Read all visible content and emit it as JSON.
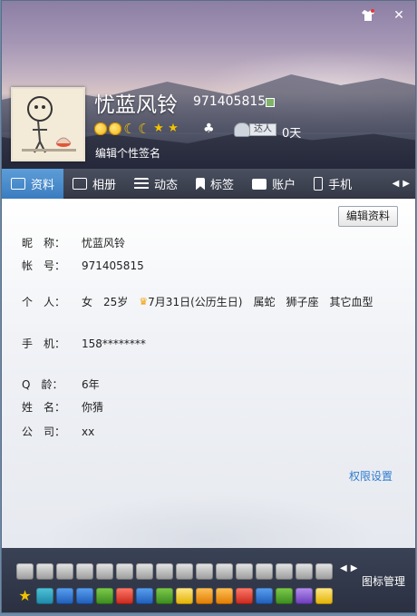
{
  "header": {
    "nickname": "忧蓝风铃",
    "qq_number": "971405815",
    "talent_badge": "达人",
    "talent_days": "0天",
    "signature_placeholder": "编辑个性签名",
    "level_icons": [
      "sun",
      "sun",
      "moon",
      "moon",
      "star",
      "star"
    ]
  },
  "tabs": [
    {
      "label": "资料",
      "icon": "profile-card-icon",
      "active": true
    },
    {
      "label": "相册",
      "icon": "photo-album-icon"
    },
    {
      "label": "动态",
      "icon": "feed-list-icon"
    },
    {
      "label": "标签",
      "icon": "bookmark-icon"
    },
    {
      "label": "账户",
      "icon": "wallet-icon"
    },
    {
      "label": "手机",
      "icon": "phone-icon"
    }
  ],
  "profile": {
    "edit_button": "编辑资料",
    "nickname_label": "昵　称：",
    "nickname_value": "忧蓝风铃",
    "account_label": "帐　号：",
    "account_value": "971405815",
    "personal_label": "个　人：",
    "gender": "女",
    "age": "25岁",
    "birthday": "7月31日(公历生日)",
    "zodiac": "属蛇",
    "constellation": "狮子座",
    "blood_type": "其它血型",
    "phone_label": "手　机：",
    "phone_value": "158********",
    "qage_label": "Q　龄：",
    "qage_value": "6年",
    "name_label": "姓　名：",
    "name_value": "你猜",
    "company_label": "公　司：",
    "company_value": "xx",
    "privacy_link": "权限设置"
  },
  "bottom": {
    "manage_label": "图标管理"
  }
}
